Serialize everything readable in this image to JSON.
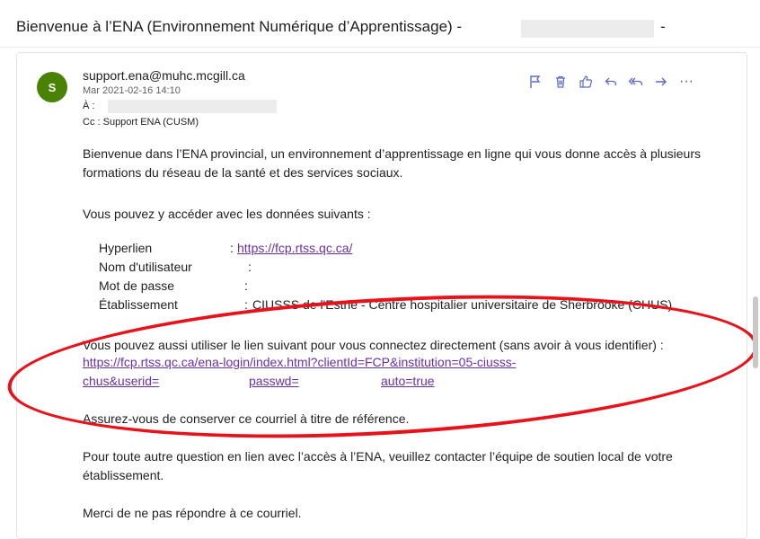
{
  "subject": "Bienvenue à l’ENA (Environnement Numérique d’Apprentissage) -",
  "subject_dash": "-",
  "avatar_letter": "S",
  "sender": "support.ena@muhc.mcgill.ca",
  "date": "Mar 2021-02-16 14:10",
  "to_label": "À :",
  "cc": "Cc : Support ENA (CUSM)",
  "actions": {
    "flag": "⚐",
    "delete": "🗑",
    "like": "👍",
    "reply": "↶",
    "reply_all": "⤺",
    "forward": "→",
    "more": "···"
  },
  "body": {
    "p1": "Bienvenue dans l’ENA provincial, un environnement d’apprentissage en ligne qui vous donne accès à plusieurs formations du réseau de la santé et des services sociaux.",
    "p2": "Vous pouvez y accéder avec les données suivants :",
    "fields": [
      {
        "label": "Hyperlien",
        "sep": ":",
        "value": "https://fcp.rtss.qc.ca/"
      },
      {
        "label": "Nom d'utilisateur",
        "sep": ":",
        "value": ""
      },
      {
        "label": "Mot de passe",
        "sep": ":",
        "value": ""
      },
      {
        "label": "Établissement",
        "sep": ":",
        "value": "CIUSSS de l'Estrie - Centre hospitalier universitaire de Sherbrooke (CHUS)"
      }
    ],
    "p3": "Vous pouvez aussi utiliser le lien suivant pour vous connectez directement (sans avoir à vous identifier) :",
    "link_line1": "https://fcp.rtss.qc.ca/ena-login/index.html?clientId=FCP&institution=05-ciusss-",
    "link_line2a": "chus&userid=",
    "link_line2b": "passwd=",
    "link_line2c": "auto=true",
    "p4": "Assurez-vous de conserver ce courriel à titre de référence.",
    "p5": "Pour toute autre question en lien avec l’accès à l’ENA, veuillez contacter l’équipe de soutien local de votre établissement.",
    "p6": "Merci de ne pas répondre à ce courriel."
  }
}
